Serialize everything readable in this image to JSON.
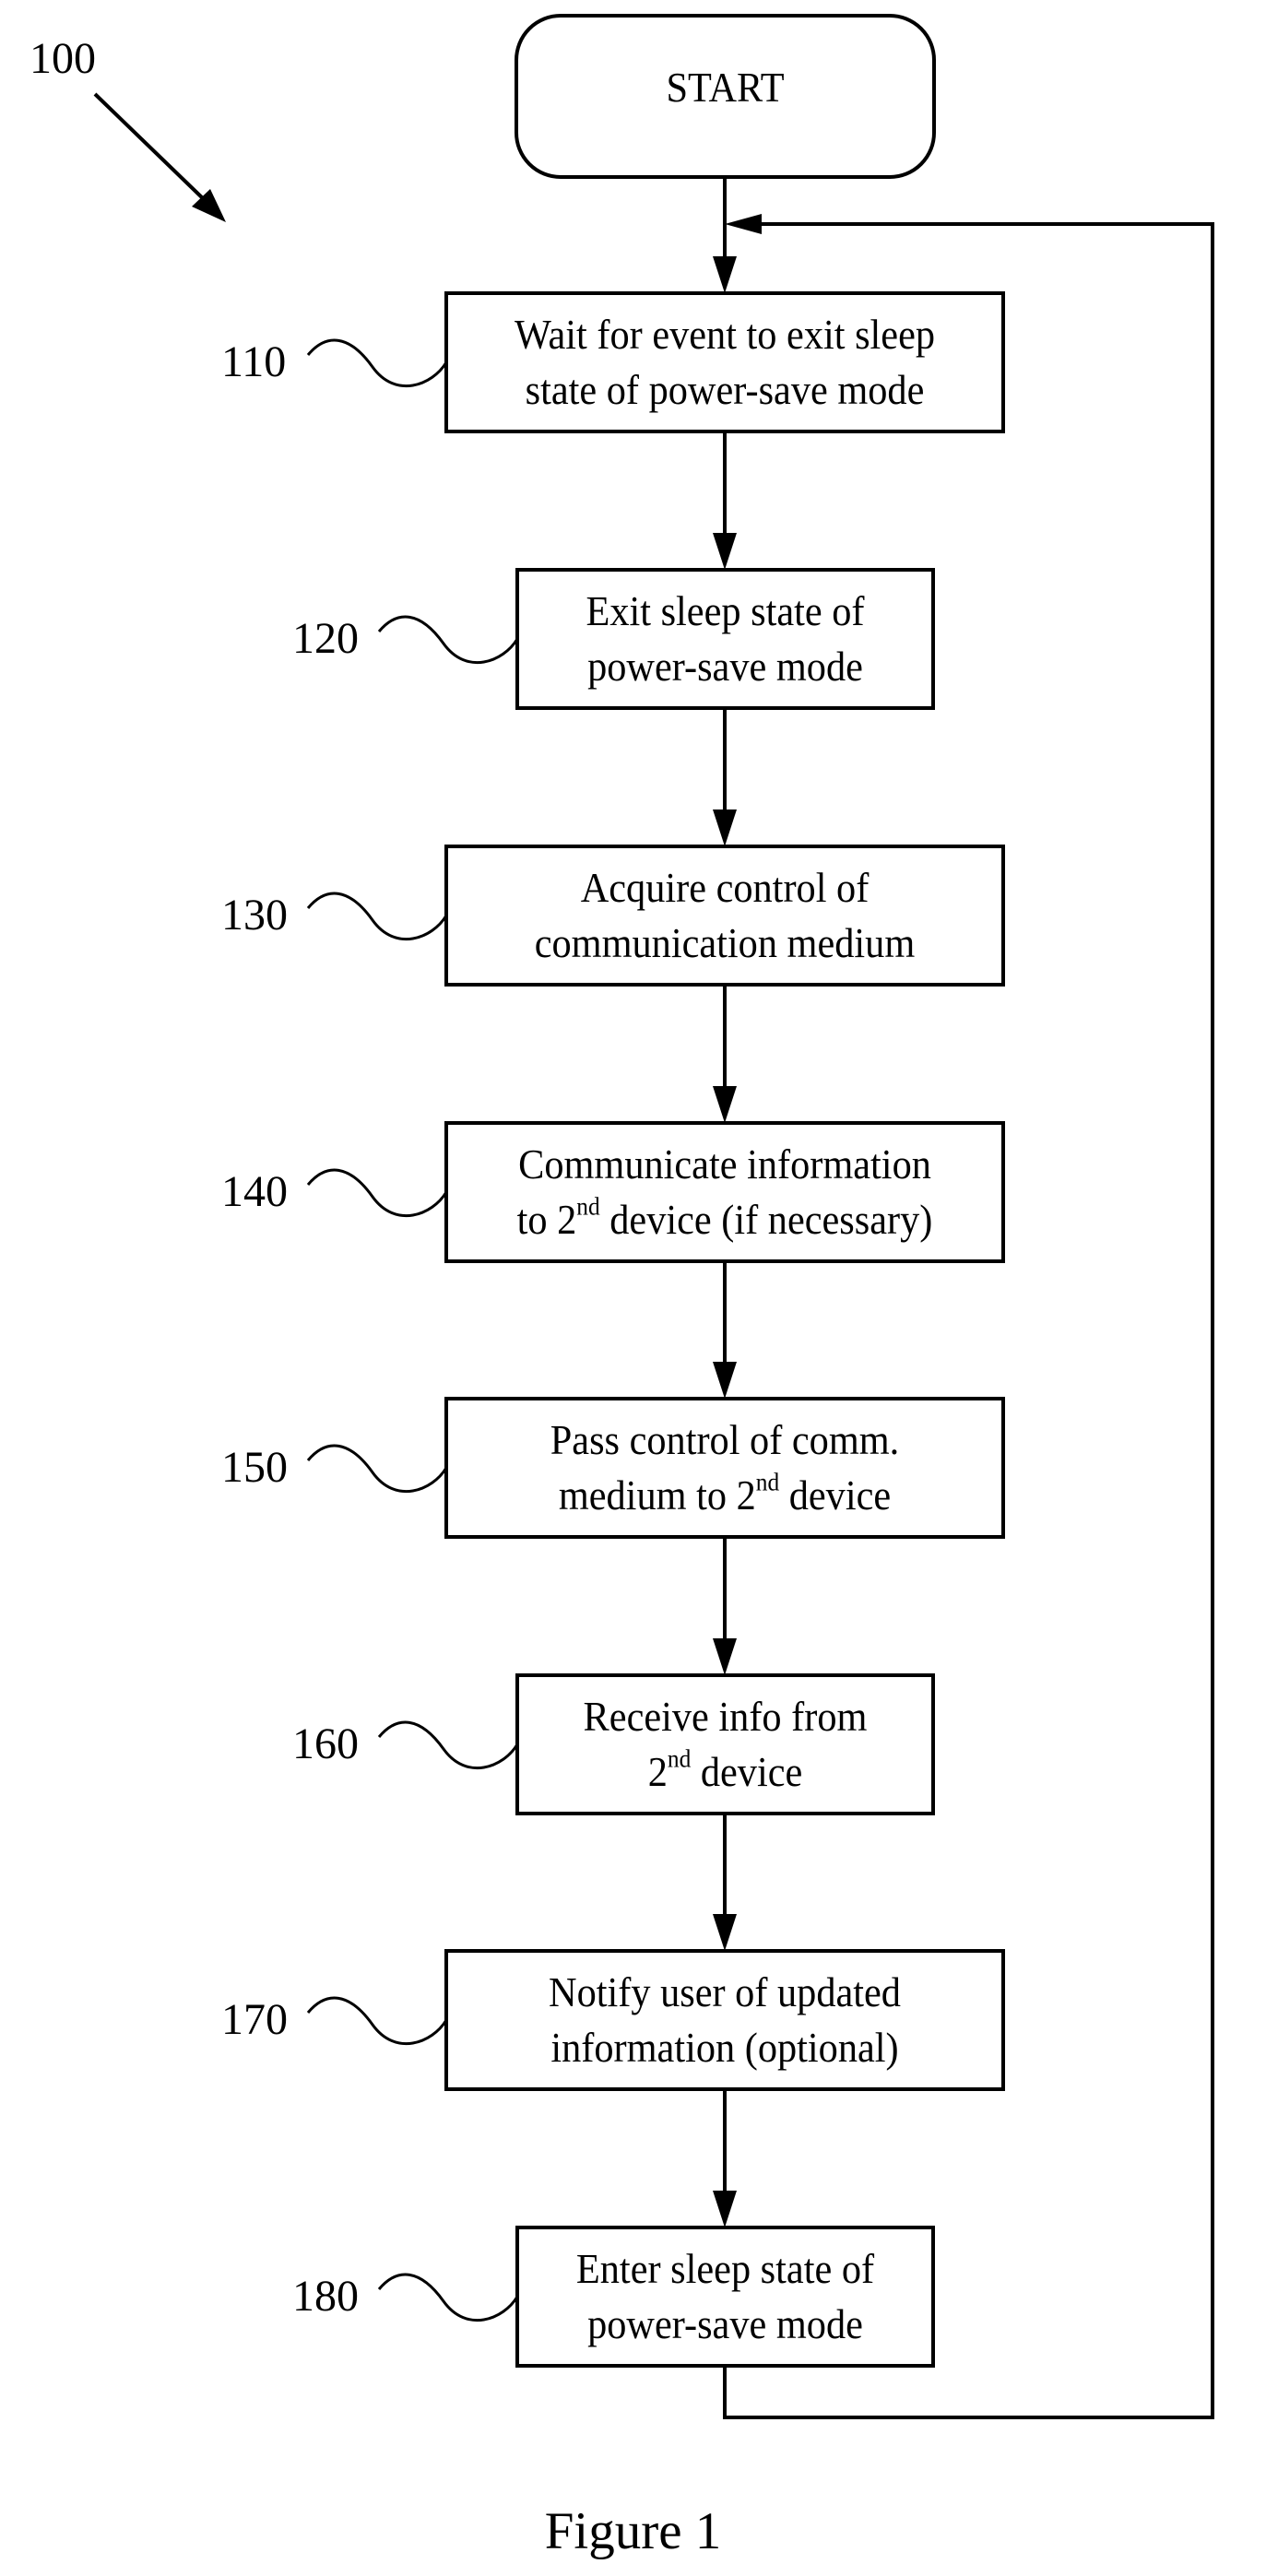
{
  "figure": {
    "reference_number": "100",
    "caption": "Figure 1",
    "start_label": "START"
  },
  "steps": [
    {
      "ref": "110",
      "lines": [
        "Wait for event to exit sleep",
        "state of power-save mode"
      ]
    },
    {
      "ref": "120",
      "lines": [
        "Exit sleep state of",
        "power-save mode"
      ]
    },
    {
      "ref": "130",
      "lines": [
        "Acquire control of",
        "communication medium"
      ]
    },
    {
      "ref": "140",
      "lines": [
        "Communicate information",
        "to 2|nd| device (if necessary)"
      ]
    },
    {
      "ref": "150",
      "lines": [
        "Pass control of comm.",
        "medium to 2|nd| device"
      ]
    },
    {
      "ref": "160",
      "lines": [
        "Receive info from",
        "2|nd| device"
      ]
    },
    {
      "ref": "170",
      "lines": [
        "Notify user of updated",
        "information (optional)"
      ]
    },
    {
      "ref": "180",
      "lines": [
        "Enter sleep state of",
        "power-save mode"
      ]
    }
  ],
  "flow": {
    "loop_back": {
      "from": "180",
      "to": "110"
    }
  },
  "colors": {
    "stroke": "#000000",
    "background": "#ffffff"
  }
}
